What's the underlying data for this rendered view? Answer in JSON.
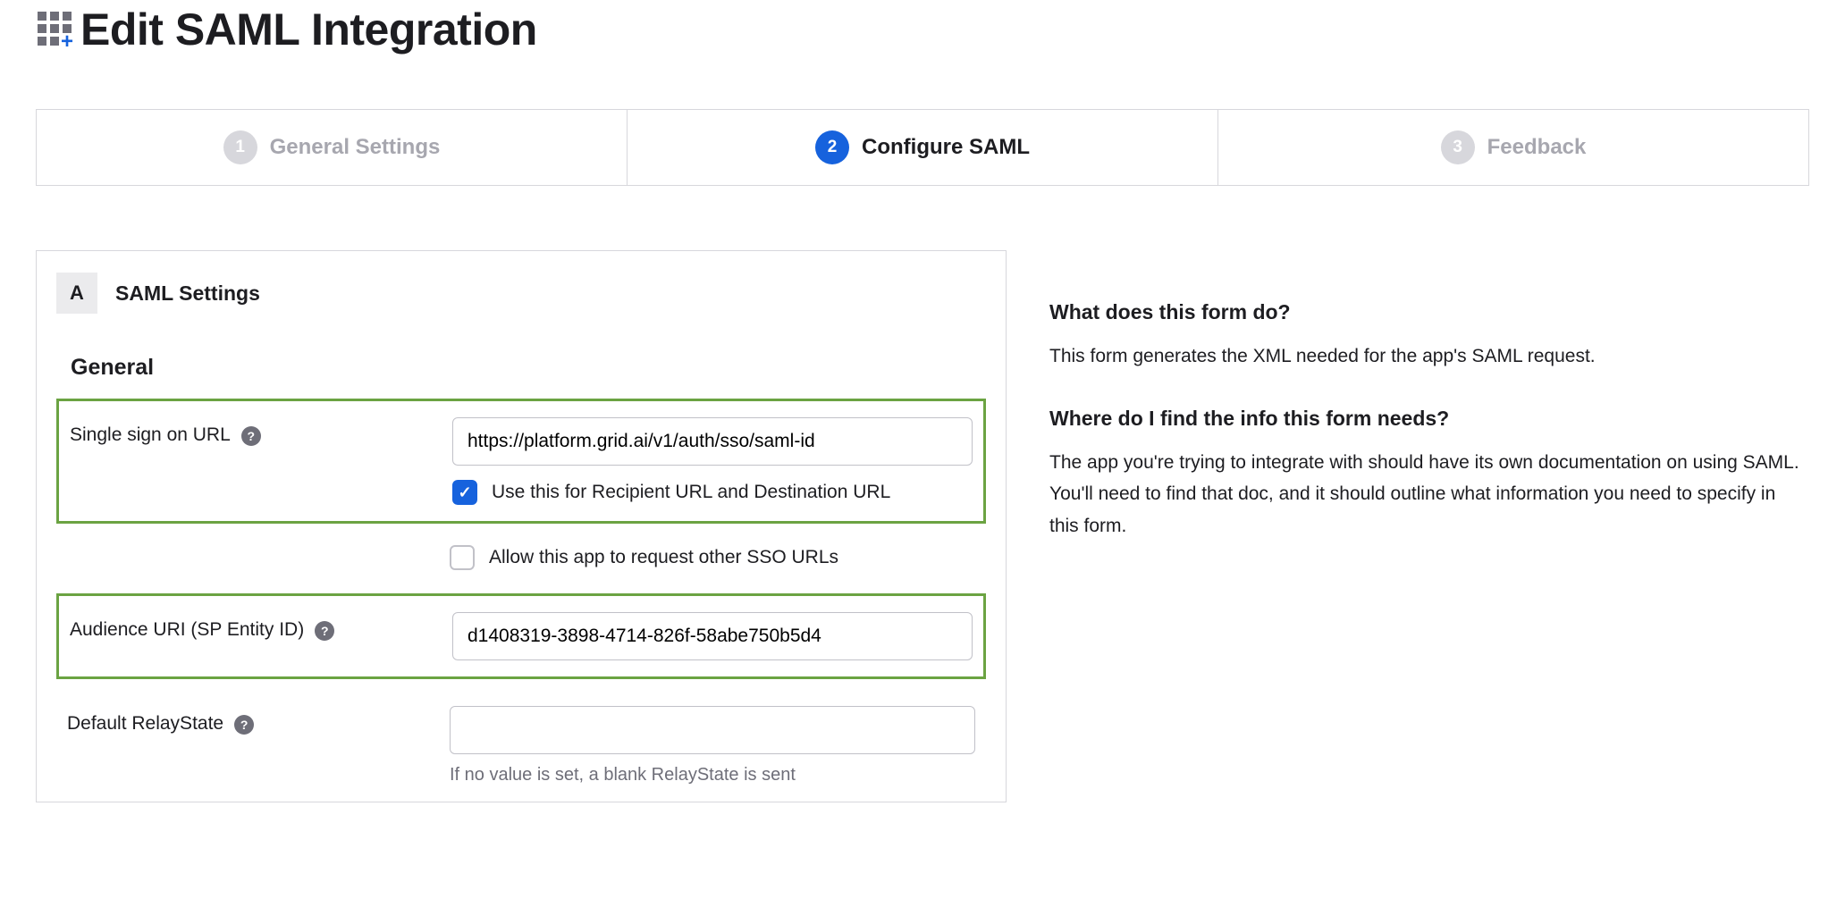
{
  "page_title": "Edit SAML Integration",
  "wizard": {
    "steps": [
      {
        "num": "1",
        "label": "General Settings",
        "active": false
      },
      {
        "num": "2",
        "label": "Configure SAML",
        "active": true
      },
      {
        "num": "3",
        "label": "Feedback",
        "active": false
      }
    ]
  },
  "section": {
    "badge": "A",
    "title": "SAML Settings",
    "subsection": "General"
  },
  "fields": {
    "sso_url": {
      "label": "Single sign on URL",
      "value": "https://platform.grid.ai/v1/auth/sso/saml-id",
      "cb_use_for_recipient_label": "Use this for Recipient URL and Destination URL",
      "cb_use_for_recipient_checked": true,
      "cb_allow_other_label": "Allow this app to request other SSO URLs",
      "cb_allow_other_checked": false
    },
    "audience_uri": {
      "label": "Audience URI (SP Entity ID)",
      "value": "d1408319-3898-4714-826f-58abe750b5d4"
    },
    "relay_state": {
      "label": "Default RelayState",
      "value": "",
      "helper": "If no value is set, a blank RelayState is sent"
    }
  },
  "help_glyph": "?",
  "sidebar": {
    "h1": "What does this form do?",
    "p1": "This form generates the XML needed for the app's SAML request.",
    "h2": "Where do I find the info this form needs?",
    "p2": "The app you're trying to integrate with should have its own documentation on using SAML. You'll need to find that doc, and it should outline what information you need to specify in this form."
  }
}
